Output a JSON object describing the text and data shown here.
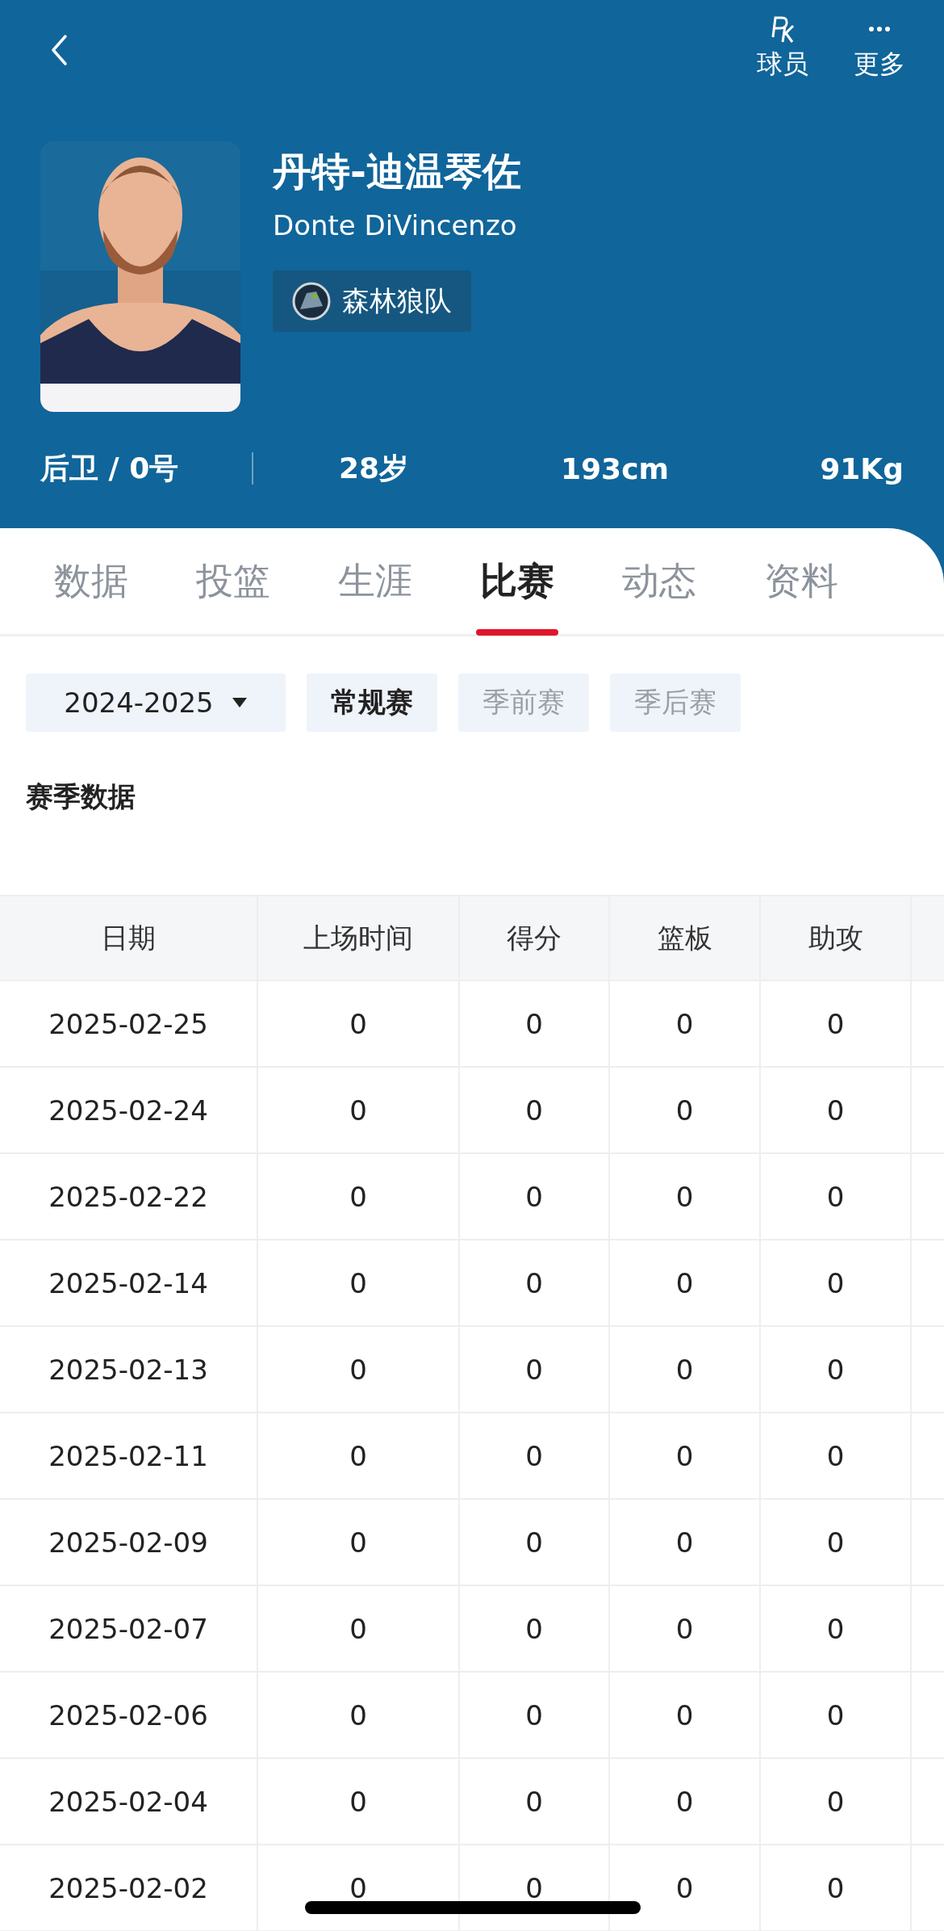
{
  "top_bar": {
    "actions": [
      {
        "kind": "pk",
        "label": "球员"
      },
      {
        "kind": "more",
        "label": "更多"
      }
    ]
  },
  "player": {
    "name_cn": "丹特-迪温琴佐",
    "name_en": "Donte DiVincenzo",
    "team": "森林狼队",
    "position": "后卫 / 0号",
    "age": "28岁",
    "height": "193cm",
    "weight": "91Kg"
  },
  "tabs": [
    {
      "label": "数据",
      "selected": false
    },
    {
      "label": "投篮",
      "selected": false
    },
    {
      "label": "生涯",
      "selected": false
    },
    {
      "label": "比赛",
      "selected": true
    },
    {
      "label": "动态",
      "selected": false
    },
    {
      "label": "资料",
      "selected": false
    }
  ],
  "filters": {
    "season": "2024-2025",
    "types": [
      {
        "label": "常规赛",
        "selected": true
      },
      {
        "label": "季前赛",
        "selected": false
      },
      {
        "label": "季后赛",
        "selected": false
      }
    ]
  },
  "section_title": "赛季数据",
  "table": {
    "columns": [
      "日期",
      "上场时间",
      "得分",
      "篮板",
      "助攻"
    ],
    "rows": [
      [
        "2025-02-25",
        "0",
        "0",
        "0",
        "0"
      ],
      [
        "2025-02-24",
        "0",
        "0",
        "0",
        "0"
      ],
      [
        "2025-02-22",
        "0",
        "0",
        "0",
        "0"
      ],
      [
        "2025-02-14",
        "0",
        "0",
        "0",
        "0"
      ],
      [
        "2025-02-13",
        "0",
        "0",
        "0",
        "0"
      ],
      [
        "2025-02-11",
        "0",
        "0",
        "0",
        "0"
      ],
      [
        "2025-02-09",
        "0",
        "0",
        "0",
        "0"
      ],
      [
        "2025-02-07",
        "0",
        "0",
        "0",
        "0"
      ],
      [
        "2025-02-06",
        "0",
        "0",
        "0",
        "0"
      ],
      [
        "2025-02-04",
        "0",
        "0",
        "0",
        "0"
      ],
      [
        "2025-02-02",
        "0",
        "0",
        "0",
        "0"
      ]
    ]
  }
}
